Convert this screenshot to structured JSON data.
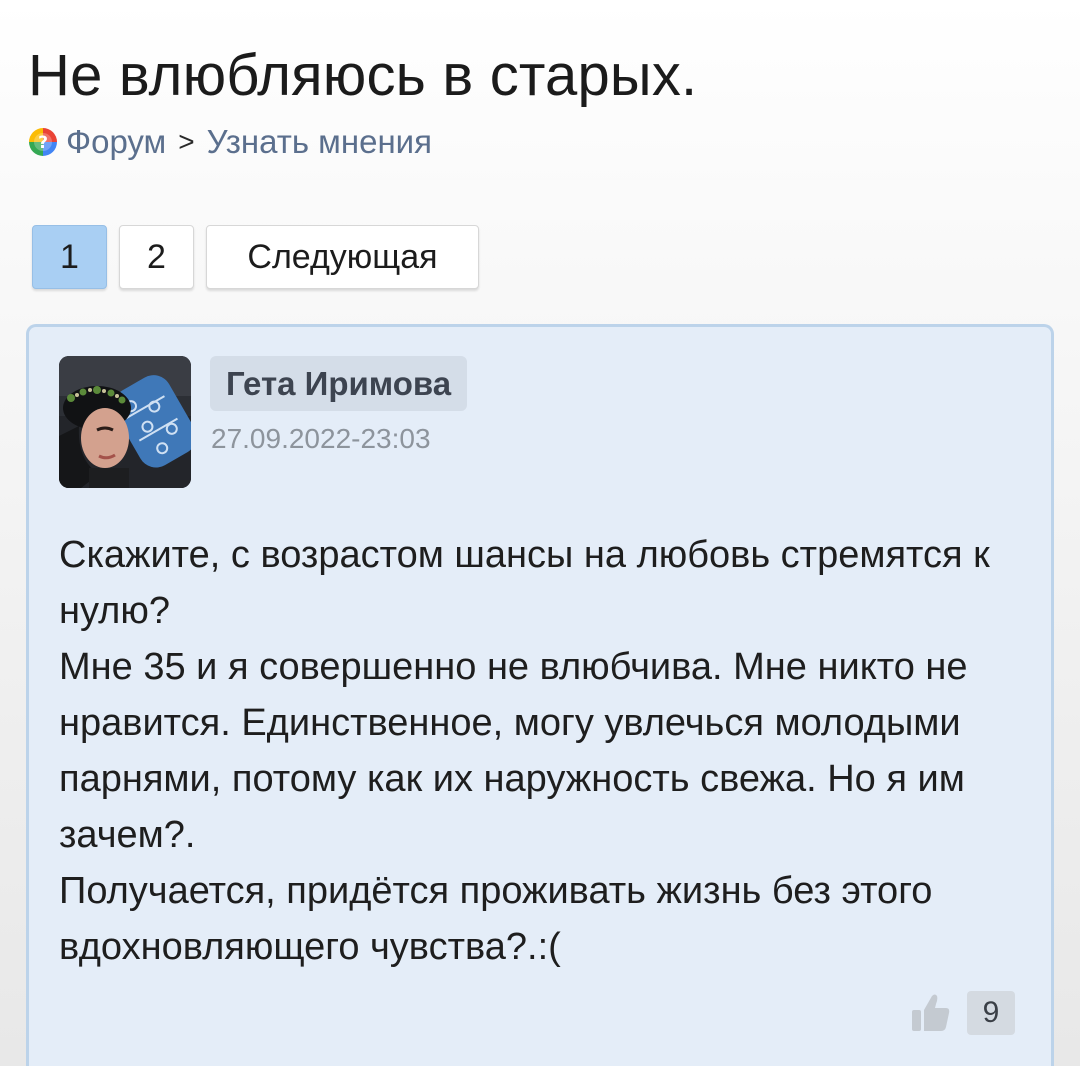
{
  "topic": {
    "title": "Не влюбляюсь в старых."
  },
  "breadcrumb": {
    "icon": "forum-icon",
    "forum_label": "Форум",
    "separator": ">",
    "section_label": "Узнать мнения"
  },
  "pagination": {
    "pages": [
      "1",
      "2"
    ],
    "current_page": "1",
    "next_label": "Следующая"
  },
  "post": {
    "author": "Гета Иримова",
    "date": "27.09.2022-23:03",
    "paragraphs": [
      "Скажите, с возрастом шансы на любовь стремятся к нулю?",
      "Мне 35 и я совершенно не влюбчива. Мне никто не нравится. Единственное, могу увлечься молодыми парнями, потому как их наружность свежа. Но я им зачем?.",
      "Получается, придётся проживать жизнь без этого вдохновляющего чувства?.:("
    ],
    "likes": "9",
    "like_icon": "thumbs-up-icon"
  },
  "colors": {
    "link": "#5b6f8d",
    "active_page": "#a9cff3",
    "card_background": "#e4edf8",
    "card_border": "#bcd3ea"
  }
}
